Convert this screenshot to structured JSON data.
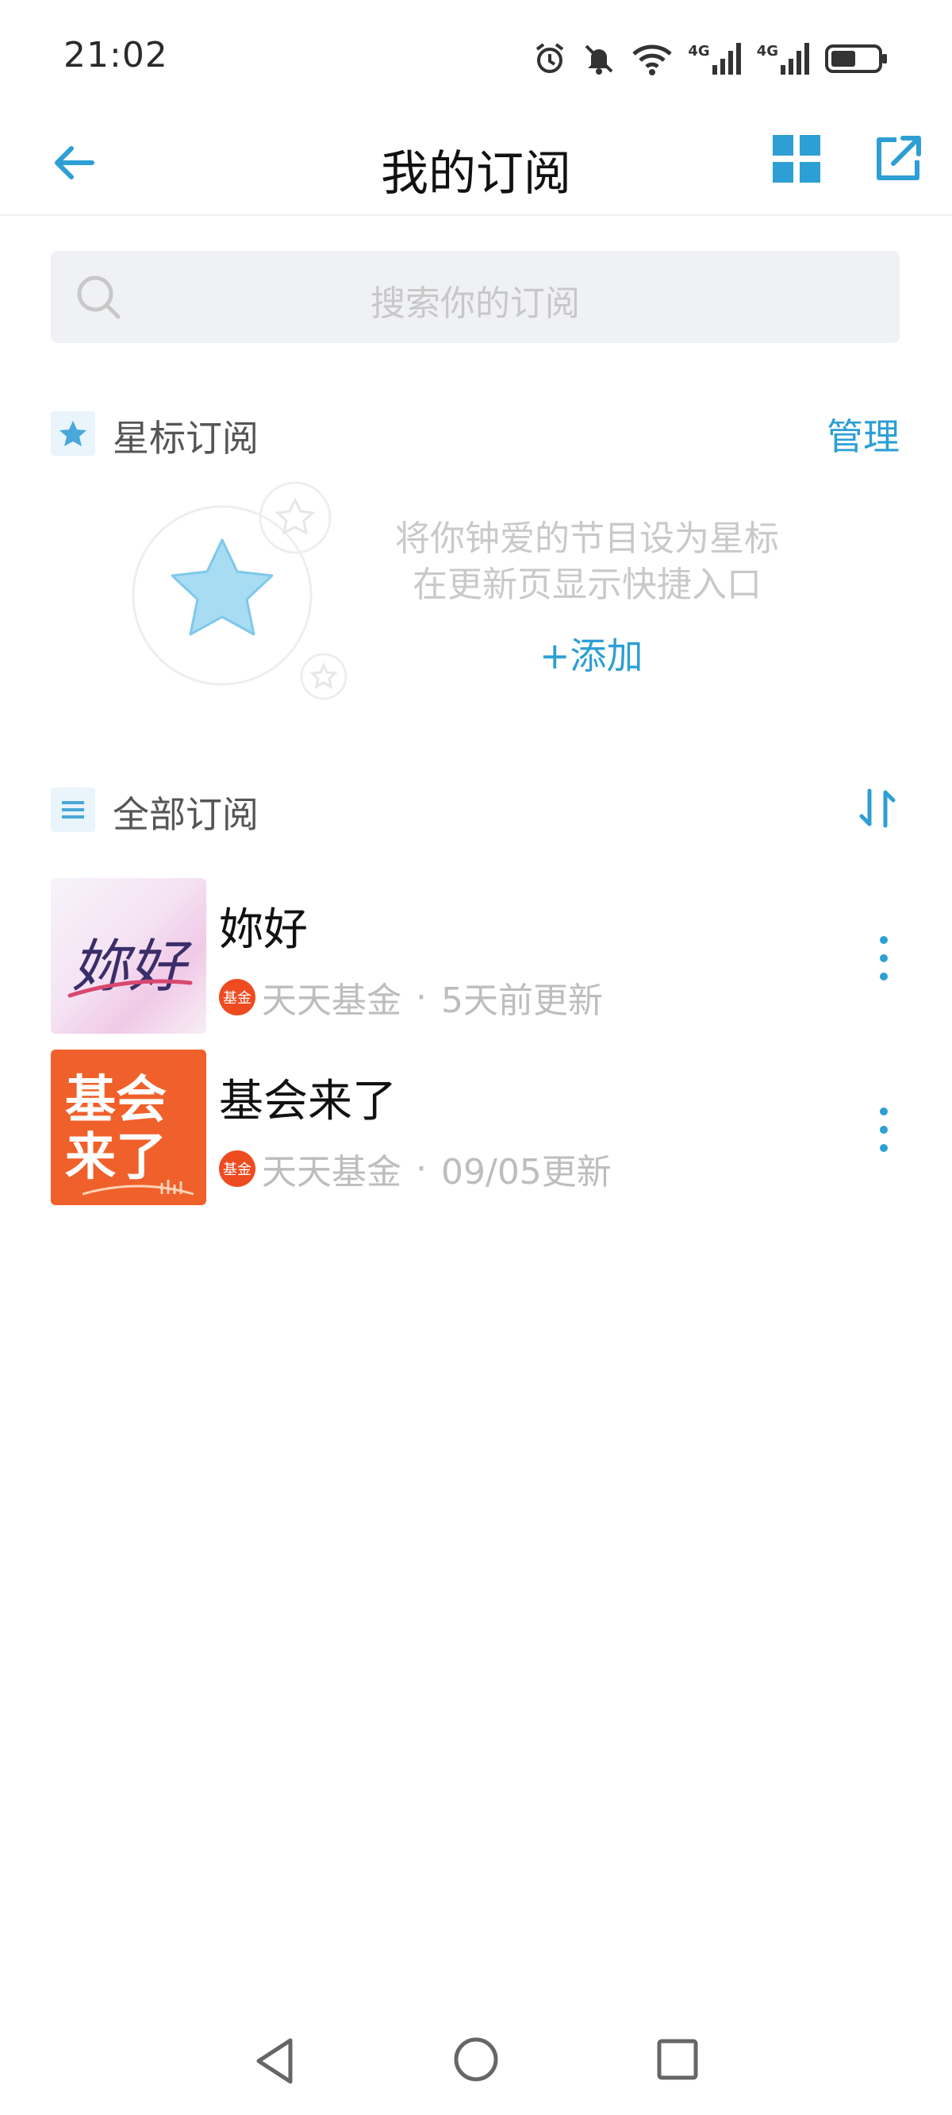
{
  "status_bar": {
    "time": "21:02",
    "icons": [
      "alarm-icon",
      "mute-icon",
      "wifi-icon",
      "4g-signal-icon",
      "4g-signal-icon",
      "battery-icon"
    ],
    "network_labels": [
      "4G",
      "4G"
    ]
  },
  "header": {
    "title": "我的订阅",
    "icons": [
      "back-arrow-icon",
      "grid-view-icon",
      "share-icon"
    ],
    "accent_color": "#2d9fd4"
  },
  "search": {
    "placeholder": "搜索你的订阅"
  },
  "starred": {
    "title": "星标订阅",
    "manage_label": "管理",
    "empty_line1": "将你钟爱的节目设为星标",
    "empty_line2": "在更新页显示快捷入口",
    "add_label": "+添加"
  },
  "all": {
    "title": "全部订阅",
    "sort_icon": "sort-icon",
    "items": [
      {
        "title": "妳好",
        "thumb_text": "妳好",
        "source": "天天基金",
        "badge_text": "基金",
        "updated": "5天前更新"
      },
      {
        "title": "基会来了",
        "thumb_text_line1": "基会",
        "thumb_text_line2": "来了",
        "source": "天天基金",
        "badge_text": "基金",
        "updated": "09/05更新"
      }
    ],
    "separator": "·"
  },
  "navbar": {
    "icons": [
      "back-triangle-icon",
      "home-circle-icon",
      "recents-square-icon"
    ]
  }
}
